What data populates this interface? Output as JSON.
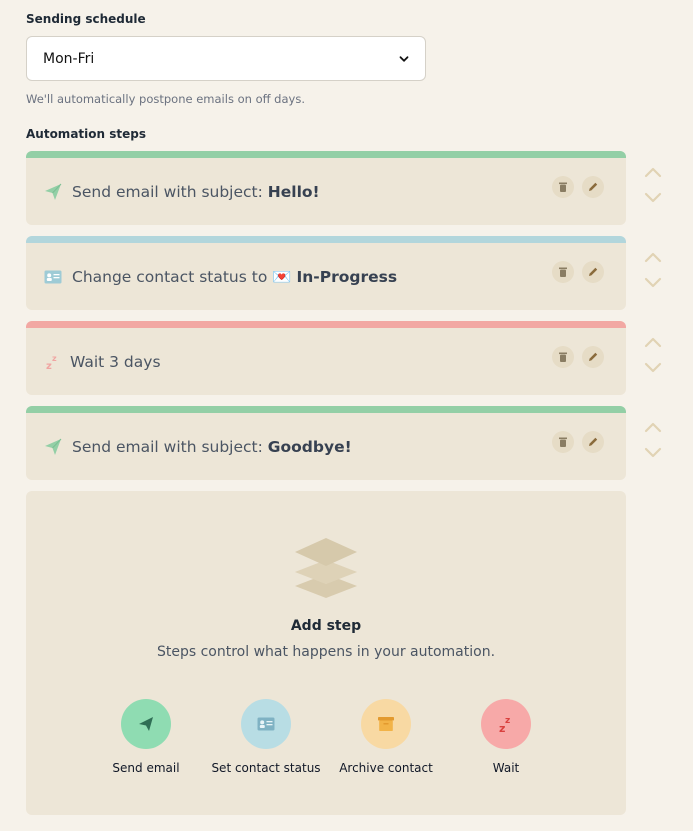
{
  "schedule": {
    "label": "Sending schedule",
    "selected": "Mon-Fri",
    "hint": "We'll automatically postpone emails on off days."
  },
  "automation": {
    "label": "Automation steps",
    "steps": [
      {
        "prefix": "Send email with subject: ",
        "emoji": "",
        "value": "Hello!",
        "icon": "paper-plane-icon",
        "color": "#93cfa6"
      },
      {
        "prefix": "Change contact status to ",
        "emoji": "💌",
        "value": "In-Progress",
        "icon": "contact-card-icon",
        "color": "#b2d6dc"
      },
      {
        "prefix": "Wait 3 days",
        "emoji": "",
        "value": "",
        "icon": "sleep-icon",
        "color": "#f2a8a3"
      },
      {
        "prefix": "Send email with subject: ",
        "emoji": "",
        "value": "Goodbye!",
        "icon": "paper-plane-icon",
        "color": "#93cfa6"
      }
    ]
  },
  "add_step": {
    "title": "Add step",
    "subtitle": "Steps control what happens in your automation.",
    "options": [
      {
        "label": "Send email",
        "icon": "paper-plane-icon",
        "color": "#8fdcb2"
      },
      {
        "label": "Set contact status",
        "icon": "contact-card-icon",
        "color": "#b8dde4"
      },
      {
        "label": "Archive contact",
        "icon": "archive-box-icon",
        "color": "#f8d9a3"
      },
      {
        "label": "Wait",
        "icon": "sleep-icon",
        "color": "#f7a9a8"
      }
    ]
  }
}
